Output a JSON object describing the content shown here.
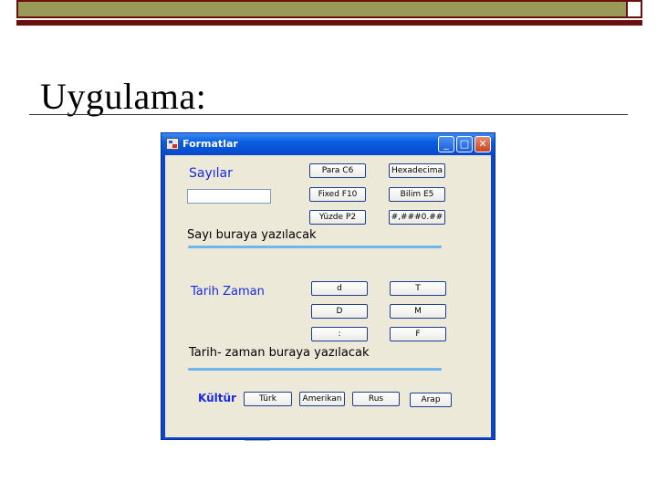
{
  "slide": {
    "title": "Uygulama:"
  },
  "window": {
    "title": "Formatlar",
    "controls": {
      "minimize": "_",
      "maximize": "□",
      "close": "✕"
    }
  },
  "numbers": {
    "label": "Sayılar",
    "input_value": "",
    "output_label": "Sayı buraya yazılacak",
    "buttons": {
      "para": "Para C6",
      "hex": "Hexadecima",
      "fixed": "Fixed F10",
      "bilimsel": "Bilim E5",
      "yuzde": "Yüzde P2",
      "custom": "#,###0.##"
    }
  },
  "datetime": {
    "label": "Tarih   Zaman",
    "output_label": "Tarih- zaman buraya yazılacak",
    "buttons": {
      "d_lower": "d",
      "t_upper": "T",
      "d_upper": "D",
      "m_upper": "M",
      "colon": ":",
      "f_upper": "F"
    }
  },
  "culture": {
    "label": "Kültür",
    "buttons": {
      "turk": "Türk",
      "amerikan": "Amerikan",
      "rus": "Rus",
      "arap": "Arap"
    }
  }
}
